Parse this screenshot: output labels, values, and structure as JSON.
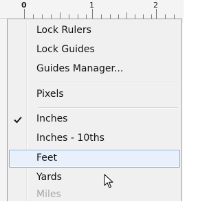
{
  "ruler": {
    "labels": [
      "0",
      "1",
      "2"
    ]
  },
  "menu": {
    "items": [
      {
        "label": "Lock Rulers"
      },
      {
        "label": "Lock Guides"
      },
      {
        "label": "Guides Manager..."
      },
      {
        "label": "Pixels"
      },
      {
        "label": "Inches",
        "checked": true
      },
      {
        "label": "Inches - 10ths"
      },
      {
        "label": "Feet",
        "highlighted": true
      },
      {
        "label": "Yards"
      },
      {
        "label": "Miles"
      }
    ]
  },
  "colors": {
    "menu_background": "#f0f0f0",
    "hover_background": "#e8f1fb",
    "hover_border": "#7ea7dc"
  },
  "icons": [
    "checkmark-icon",
    "mouse-pointer-icon"
  ]
}
